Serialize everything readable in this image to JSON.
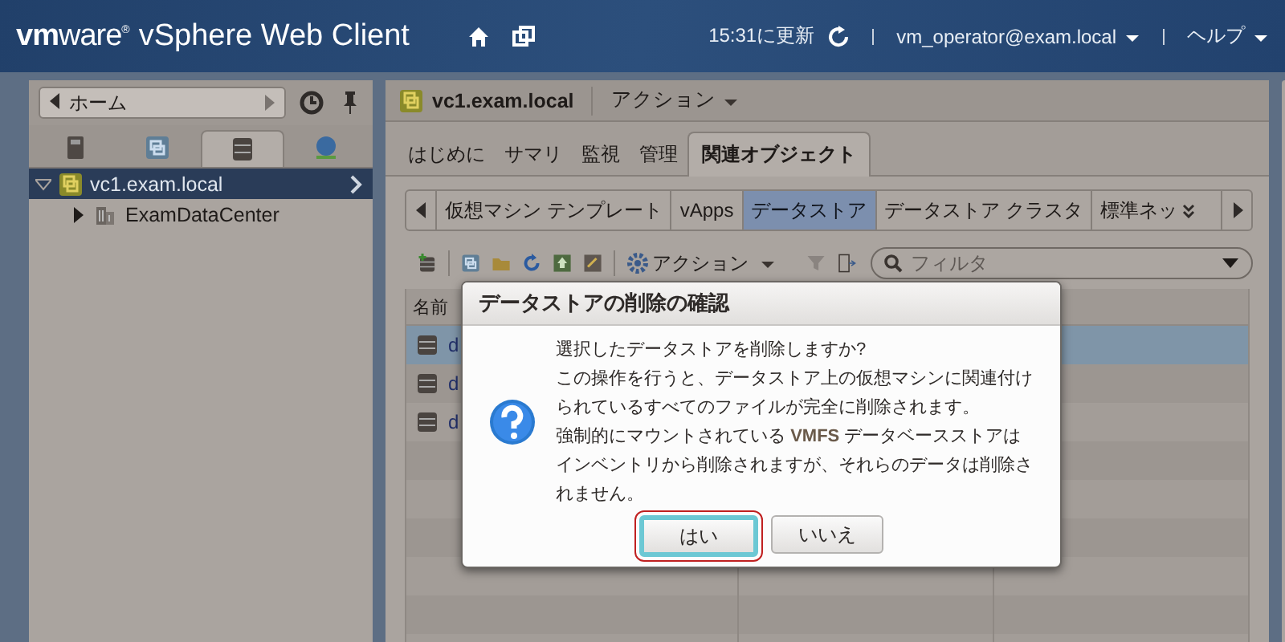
{
  "header": {
    "brand": "**vm**ware$^{®}$",
    "product": "vSphere Web Client",
    "updated": "15:31に更新",
    "user": "vm_operator@exam.local",
    "help": "ヘルプ"
  },
  "navigator": {
    "back_label": "ホーム",
    "icon_tabs": [
      {
        "kind": "hosts",
        "selected": false
      },
      {
        "kind": "vms",
        "selected": false
      },
      {
        "kind": "storage",
        "selected": true
      },
      {
        "kind": "network",
        "selected": false
      }
    ],
    "tree": [
      {
        "label": "vc1.exam.local",
        "expanded": true,
        "selected": true,
        "children": [
          {
            "label": "ExamDataCenter",
            "expanded": false,
            "selected": false
          }
        ]
      }
    ]
  },
  "object": {
    "title": "vc1.exam.local",
    "actions": "アクション",
    "tabs": [
      {
        "label": "はじめに",
        "selected": false
      },
      {
        "label": "サマリ",
        "selected": false
      },
      {
        "label": "監視",
        "selected": false
      },
      {
        "label": "管理",
        "selected": false
      },
      {
        "label": "関連オブジェクト",
        "selected": true
      }
    ],
    "subtabs": [
      {
        "label": "仮想マシン テンプレート",
        "selected": false
      },
      {
        "label": "vApps",
        "selected": false
      },
      {
        "label": "データストア",
        "selected": true
      },
      {
        "label": "データストア クラスタ",
        "selected": false
      },
      {
        "label": "標準ネッ",
        "selected": false
      }
    ]
  },
  "toolbar": {
    "actions": "アクション",
    "filter_placeholder": "フィルタ"
  },
  "table": {
    "columns": [
      "名前"
    ],
    "rows": [
      {
        "name": "d",
        "selected": true
      },
      {
        "name": "d",
        "selected": false
      },
      {
        "name": "d",
        "selected": false
      }
    ]
  },
  "dialog": {
    "title": "データストアの削除の確認",
    "messages": [
      "選択したデータストアを削除しますか?",
      "この操作を行うと、データストア上の仮想マシンに関連付けられているすべてのファイルが完全に削除されます。",
      "強制的にマウントされている **VMFS** データベースストアはインベントリから削除されますが、それらのデータは削除されません。"
    ],
    "buttons": [
      {
        "label": "はい",
        "focused": true
      },
      {
        "label": "いいえ",
        "focused": false
      }
    ]
  }
}
